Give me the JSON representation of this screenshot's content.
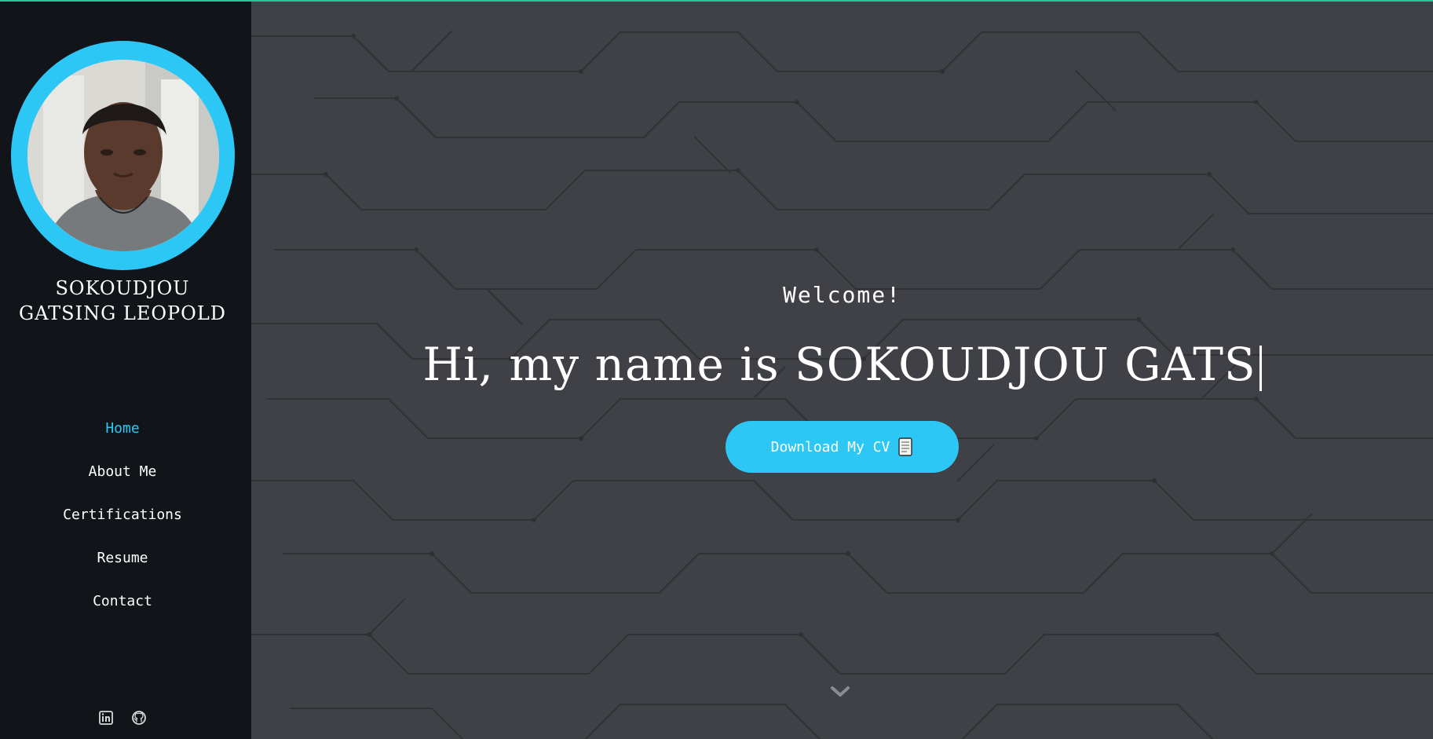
{
  "profile": {
    "name_line1": "SOKOUDJOU",
    "name_line2": "GATSING LEOPOLD",
    "avatar_icon": "profile-photo"
  },
  "sidebar": {
    "items": [
      {
        "label": "Home",
        "active": true
      },
      {
        "label": "About Me",
        "active": false
      },
      {
        "label": "Certifications",
        "active": false
      },
      {
        "label": "Resume",
        "active": false
      },
      {
        "label": "Contact",
        "active": false
      }
    ],
    "social_icons": [
      "linkedin-icon",
      "github-icon"
    ]
  },
  "hero": {
    "welcome": "Welcome!",
    "headline": "Hi, my name is SOKOUDJOU GATS",
    "button_label": "Download My CV",
    "button_icon": "document-icon",
    "scroll_icon": "chevron-down-icon"
  },
  "colors": {
    "accent": "#2dc7f5",
    "sidebar_bg": "#111419",
    "main_bg": "#3f4146",
    "top_line": "#20c997"
  }
}
